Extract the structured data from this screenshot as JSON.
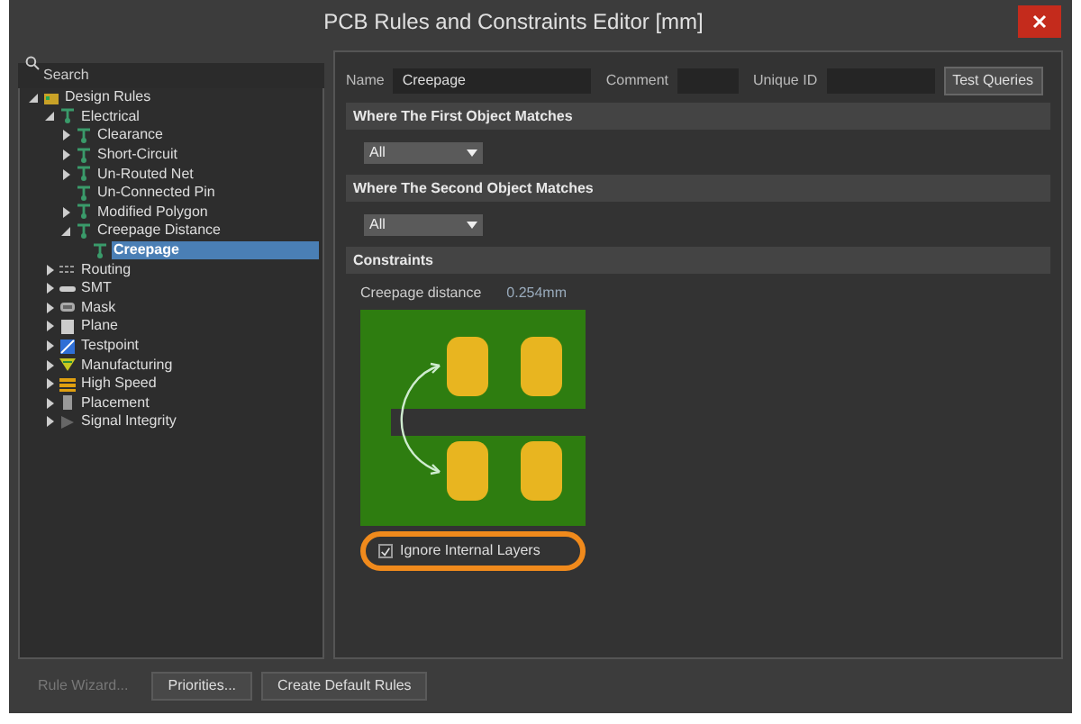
{
  "window": {
    "title": "PCB Rules and Constraints Editor [mm]"
  },
  "search": {
    "placeholder": "Search"
  },
  "tree": [
    {
      "label": "Design Rules",
      "kind": "folder",
      "expanded": true,
      "selected": false,
      "children": [
        {
          "label": "Electrical",
          "kind": "rule",
          "expanded": true,
          "selected": false,
          "children": [
            {
              "label": "Clearance",
              "kind": "rule",
              "expanded": false,
              "selected": false
            },
            {
              "label": "Short-Circuit",
              "kind": "rule",
              "expanded": false,
              "selected": false
            },
            {
              "label": "Un-Routed Net",
              "kind": "rule",
              "expanded": false,
              "selected": false
            },
            {
              "label": "Un-Connected Pin",
              "kind": "rule",
              "selected": false
            },
            {
              "label": "Modified Polygon",
              "kind": "rule",
              "expanded": false,
              "selected": false
            },
            {
              "label": "Creepage Distance",
              "kind": "rule",
              "expanded": true,
              "selected": false,
              "children": [
                {
                  "label": "Creepage",
                  "kind": "rule",
                  "selected": true
                }
              ]
            }
          ]
        },
        {
          "label": "Routing",
          "kind": "routing",
          "expanded": false,
          "selected": false
        },
        {
          "label": "SMT",
          "kind": "smt",
          "expanded": false,
          "selected": false
        },
        {
          "label": "Mask",
          "kind": "mask",
          "expanded": false,
          "selected": false
        },
        {
          "label": "Plane",
          "kind": "plane",
          "expanded": false,
          "selected": false
        },
        {
          "label": "Testpoint",
          "kind": "testpoint",
          "expanded": false,
          "selected": false
        },
        {
          "label": "Manufacturing",
          "kind": "manufacturing",
          "expanded": false,
          "selected": false
        },
        {
          "label": "High Speed",
          "kind": "highspeed",
          "expanded": false,
          "selected": false
        },
        {
          "label": "Placement",
          "kind": "placement",
          "expanded": false,
          "selected": false
        },
        {
          "label": "Signal Integrity",
          "kind": "signal",
          "expanded": false,
          "selected": false
        }
      ]
    }
  ],
  "fields": {
    "name_label": "Name",
    "name_value": "Creepage",
    "comment_label": "Comment",
    "unique_id_label": "Unique ID",
    "test_button": "Test Queries"
  },
  "sections": [
    {
      "title": "Where The First Object Matches",
      "dropdown": "All"
    },
    {
      "title": "Where The Second Object Matches",
      "dropdown": "All"
    },
    {
      "title": "Constraints"
    }
  ],
  "constraint": {
    "label": "Creepage distance",
    "value": "0.254mm",
    "checkbox": {
      "label": "Ignore Internal Layers",
      "checked": true
    }
  },
  "footer_buttons": [
    {
      "label": "Rule Wizard...",
      "disabled": true
    },
    {
      "label": "Priorities...",
      "disabled": false
    },
    {
      "label": "Create Default Rules",
      "disabled": false
    }
  ]
}
